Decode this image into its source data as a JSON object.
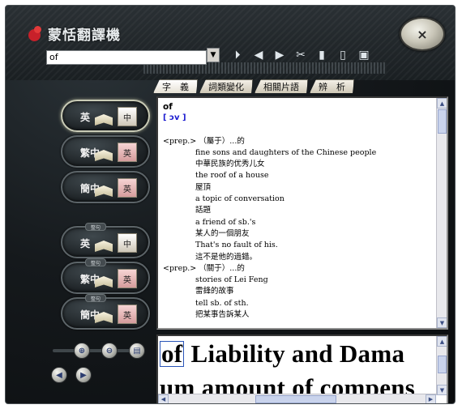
{
  "app": {
    "title": "蒙恬翻譯機"
  },
  "search": {
    "value": "of",
    "dropdown_glyph": "▼"
  },
  "toolbar": {
    "buttons": [
      {
        "name": "lookup-icon",
        "glyph": "⏵"
      },
      {
        "name": "back-icon",
        "glyph": "◀"
      },
      {
        "name": "forward-icon",
        "glyph": "▶"
      },
      {
        "name": "scissors-icon",
        "glyph": "✂"
      },
      {
        "name": "copy-icon",
        "glyph": "▮"
      },
      {
        "name": "paste-icon",
        "glyph": "▯"
      },
      {
        "name": "help-monitor-icon",
        "glyph": "▣"
      }
    ]
  },
  "tabs": [
    "字　義",
    "詞類變化",
    "相關片語",
    "辨　析"
  ],
  "modes": [
    {
      "src": "英",
      "tgt": "中",
      "badge": ""
    },
    {
      "src": "繁中",
      "tgt": "英",
      "badge": ""
    },
    {
      "src": "簡中",
      "tgt": "英",
      "badge": ""
    },
    {
      "src": "英",
      "tgt": "中",
      "badge": "整句"
    },
    {
      "src": "繁中",
      "tgt": "英",
      "badge": "整句"
    },
    {
      "src": "簡中",
      "tgt": "英",
      "badge": "整句"
    }
  ],
  "definition": {
    "word": "of",
    "phonetic": "[ ɔv ]",
    "lines": [
      {
        "type": "pos",
        "text": "<prep.> （屬于）...的"
      },
      {
        "type": "ex",
        "text": "fine sons and daughters of the Chinese people"
      },
      {
        "type": "ex",
        "text": "中華民族的优秀儿女"
      },
      {
        "type": "ex",
        "text": "the roof of a house"
      },
      {
        "type": "ex",
        "text": "屋頂"
      },
      {
        "type": "ex",
        "text": "a topic of conversation"
      },
      {
        "type": "ex",
        "text": "話題"
      },
      {
        "type": "ex",
        "text": "a friend of sb.'s"
      },
      {
        "type": "ex",
        "text": "某人的一個朋友"
      },
      {
        "type": "ex",
        "text": "That's no fault of his."
      },
      {
        "type": "ex",
        "text": "這不是他的過錯。"
      },
      {
        "type": "pos",
        "text": "<prep.> （關于）...的"
      },
      {
        "type": "ex",
        "text": "stories of Lei Feng"
      },
      {
        "type": "ex",
        "text": "雷鋒的故事"
      },
      {
        "type": "ex",
        "text": "tell sb. of sth."
      },
      {
        "type": "ex",
        "text": "把某事告訴某人"
      }
    ]
  },
  "ocr": {
    "highlight": "of",
    "line1_rest": " Liability and Dama",
    "line2": "um amount of compens"
  },
  "controls": {
    "zoom_in": "⊕",
    "zoom_out": "⊖",
    "scan": "▤",
    "prev": "◀",
    "next": "▶"
  }
}
